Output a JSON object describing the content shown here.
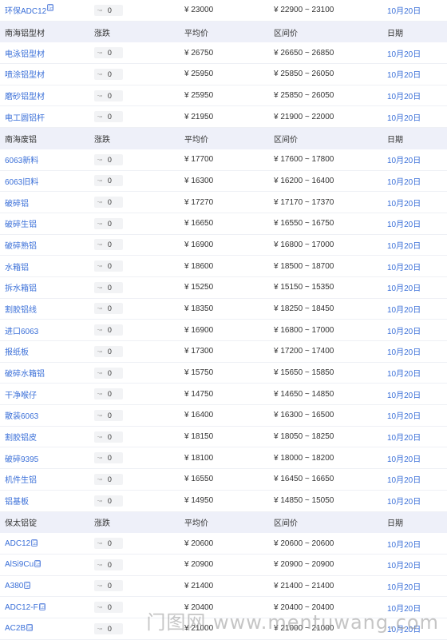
{
  "sections": [
    {
      "header": null,
      "rows": [
        {
          "name": "环保ADC12",
          "badge": true,
          "change": "0",
          "avg": "¥ 23000",
          "range": "¥ 22900 ~ 23100",
          "date": "10月20日"
        }
      ]
    },
    {
      "header": {
        "name": "南海铝型材",
        "change": "涨跌",
        "avg": "平均价",
        "range": "区间价",
        "date": "日期"
      },
      "rows": [
        {
          "name": "电泳铝型材",
          "badge": false,
          "change": "0",
          "avg": "¥ 26750",
          "range": "¥ 26650 ~ 26850",
          "date": "10月20日"
        },
        {
          "name": "喷涂铝型材",
          "badge": false,
          "change": "0",
          "avg": "¥ 25950",
          "range": "¥ 25850 ~ 26050",
          "date": "10月20日"
        },
        {
          "name": "磨砂铝型材",
          "badge": false,
          "change": "0",
          "avg": "¥ 25950",
          "range": "¥ 25850 ~ 26050",
          "date": "10月20日"
        },
        {
          "name": "电工圆铝杆",
          "badge": false,
          "change": "0",
          "avg": "¥ 21950",
          "range": "¥ 21900 ~ 22000",
          "date": "10月20日"
        }
      ]
    },
    {
      "header": {
        "name": "南海废铝",
        "change": "涨跌",
        "avg": "平均价",
        "range": "区间价",
        "date": "日期"
      },
      "rows": [
        {
          "name": "6063新料",
          "badge": false,
          "change": "0",
          "avg": "¥ 17700",
          "range": "¥ 17600 ~ 17800",
          "date": "10月20日"
        },
        {
          "name": "6063旧料",
          "badge": false,
          "change": "0",
          "avg": "¥ 16300",
          "range": "¥ 16200 ~ 16400",
          "date": "10月20日"
        },
        {
          "name": "破碎铝",
          "badge": false,
          "change": "0",
          "avg": "¥ 17270",
          "range": "¥ 17170 ~ 17370",
          "date": "10月20日"
        },
        {
          "name": "破碎生铝",
          "badge": false,
          "change": "0",
          "avg": "¥ 16650",
          "range": "¥ 16550 ~ 16750",
          "date": "10月20日"
        },
        {
          "name": "破碎熟铝",
          "badge": false,
          "change": "0",
          "avg": "¥ 16900",
          "range": "¥ 16800 ~ 17000",
          "date": "10月20日"
        },
        {
          "name": "水箱铝",
          "badge": false,
          "change": "0",
          "avg": "¥ 18600",
          "range": "¥ 18500 ~ 18700",
          "date": "10月20日"
        },
        {
          "name": "拆水箱铝",
          "badge": false,
          "change": "0",
          "avg": "¥ 15250",
          "range": "¥ 15150 ~ 15350",
          "date": "10月20日"
        },
        {
          "name": "割胶铝线",
          "badge": false,
          "change": "0",
          "avg": "¥ 18350",
          "range": "¥ 18250 ~ 18450",
          "date": "10月20日"
        },
        {
          "name": "进口6063",
          "badge": false,
          "change": "0",
          "avg": "¥ 16900",
          "range": "¥ 16800 ~ 17000",
          "date": "10月20日"
        },
        {
          "name": "报纸板",
          "badge": false,
          "change": "0",
          "avg": "¥ 17300",
          "range": "¥ 17200 ~ 17400",
          "date": "10月20日"
        },
        {
          "name": "破碎水箱铝",
          "badge": false,
          "change": "0",
          "avg": "¥ 15750",
          "range": "¥ 15650 ~ 15850",
          "date": "10月20日"
        },
        {
          "name": "干净喉仔",
          "badge": false,
          "change": "0",
          "avg": "¥ 14750",
          "range": "¥ 14650 ~ 14850",
          "date": "10月20日"
        },
        {
          "name": "散装6063",
          "badge": false,
          "change": "0",
          "avg": "¥ 16400",
          "range": "¥ 16300 ~ 16500",
          "date": "10月20日"
        },
        {
          "name": "割胶铝皮",
          "badge": false,
          "change": "0",
          "avg": "¥ 18150",
          "range": "¥ 18050 ~ 18250",
          "date": "10月20日"
        },
        {
          "name": "破碎9395",
          "badge": false,
          "change": "0",
          "avg": "¥ 18100",
          "range": "¥ 18000 ~ 18200",
          "date": "10月20日"
        },
        {
          "name": "机件生铝",
          "badge": false,
          "change": "0",
          "avg": "¥ 16550",
          "range": "¥ 16450 ~ 16650",
          "date": "10月20日"
        },
        {
          "name": "铝基板",
          "badge": false,
          "change": "0",
          "avg": "¥ 14950",
          "range": "¥ 14850 ~ 15050",
          "date": "10月20日"
        }
      ]
    },
    {
      "header": {
        "name": "保太铝锭",
        "change": "涨跌",
        "avg": "平均价",
        "range": "区间价",
        "date": "日期"
      },
      "rows": [
        {
          "name": "ADC12",
          "badge": true,
          "change": "0",
          "avg": "¥ 20600",
          "range": "¥ 20600 ~ 20600",
          "date": "10月20日"
        },
        {
          "name": "AlSi9Cu",
          "badge": true,
          "change": "0",
          "avg": "¥ 20900",
          "range": "¥ 20900 ~ 20900",
          "date": "10月20日"
        },
        {
          "name": "A380",
          "badge": true,
          "change": "0",
          "avg": "¥ 21400",
          "range": "¥ 21400 ~ 21400",
          "date": "10月20日"
        },
        {
          "name": "ADC12-F",
          "badge": true,
          "change": "0",
          "avg": "¥ 20400",
          "range": "¥ 20400 ~ 20400",
          "date": "10月20日"
        },
        {
          "name": "AC2B",
          "badge": true,
          "change": "0",
          "avg": "¥ 21000",
          "range": "¥ 21000 ~ 21000",
          "date": "10月20日"
        }
      ]
    }
  ],
  "watermark": "门图网 www.mentuwang.com",
  "icons": {
    "change_arrow": "trend-arrow-icon",
    "badge": "verified-badge-icon"
  },
  "colors": {
    "link": "#3a6fd8",
    "header_bg": "#eef0f9",
    "change_bg": "#f2f3f5"
  }
}
